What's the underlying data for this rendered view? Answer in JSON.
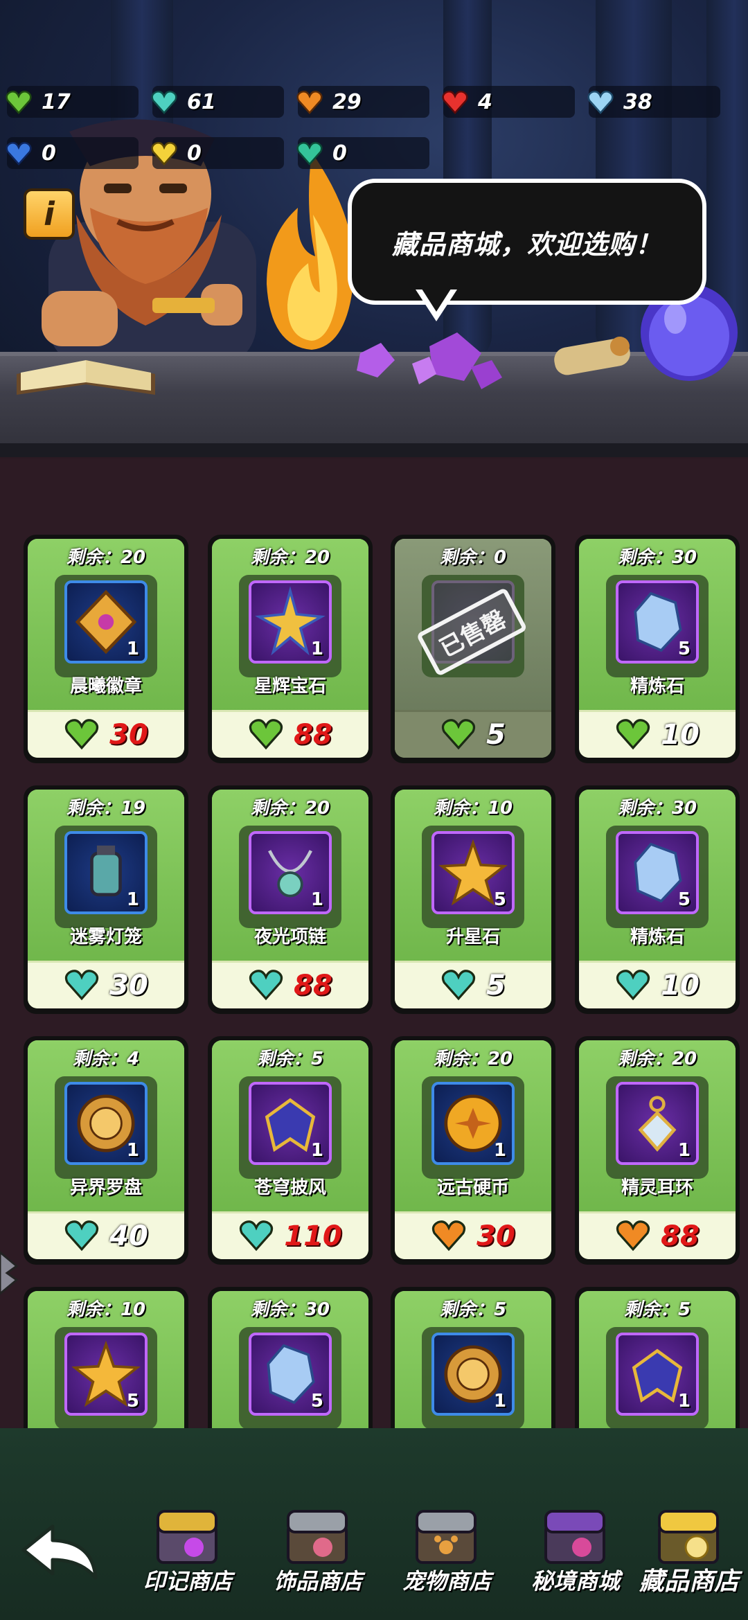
{
  "resources": [
    {
      "icon": "green-heart-gem-icon",
      "color": "#6cc63a",
      "value": "17"
    },
    {
      "icon": "cyan-heart-gem-icon",
      "color": "#4ed0c0",
      "value": "61"
    },
    {
      "icon": "orange-heart-gem-icon",
      "color": "#f08a24",
      "value": "29"
    },
    {
      "icon": "red-heart-gem-icon",
      "color": "#e8322e",
      "value": "4"
    },
    {
      "icon": "lightblue-heart-gem-icon",
      "color": "#9cd4f4",
      "value": "38"
    },
    {
      "icon": "blue-heart-gem-icon",
      "color": "#3a78e0",
      "value": "0"
    },
    {
      "icon": "gold-heart-gem-icon",
      "color": "#f4d23a",
      "value": "0"
    },
    {
      "icon": "teal-heart-gem-icon",
      "color": "#34c49a",
      "value": "0"
    }
  ],
  "info_button": "i",
  "speech_bubble": "藏品商城，欢迎选购！",
  "items": [
    {
      "stock": "剩余：20",
      "name": "晨曦徽章",
      "qty": "1",
      "frame": "blue",
      "icon": "badge-icon",
      "currency": "green",
      "price": "30",
      "price_red": true,
      "sold_out": false
    },
    {
      "stock": "剩余：20",
      "name": "星辉宝石",
      "qty": "1",
      "frame": "purple",
      "icon": "star-gem-icon",
      "currency": "green",
      "price": "88",
      "price_red": true,
      "sold_out": false
    },
    {
      "stock": "剩余：0",
      "name": "",
      "qty": "",
      "frame": "purple",
      "icon": "",
      "currency": "green",
      "price": "5",
      "price_red": false,
      "sold_out": true,
      "stamp": "已售罄"
    },
    {
      "stock": "剩余：30",
      "name": "精炼石",
      "qty": "5",
      "frame": "purple",
      "icon": "crystal-icon",
      "currency": "green",
      "price": "10",
      "price_red": false,
      "sold_out": false
    },
    {
      "stock": "剩余：19",
      "name": "迷雾灯笼",
      "qty": "1",
      "frame": "blue",
      "icon": "lantern-icon",
      "currency": "cyan",
      "price": "30",
      "price_red": false,
      "sold_out": false
    },
    {
      "stock": "剩余：20",
      "name": "夜光项链",
      "qty": "1",
      "frame": "purple",
      "icon": "necklace-icon",
      "currency": "cyan",
      "price": "88",
      "price_red": true,
      "sold_out": false
    },
    {
      "stock": "剩余：10",
      "name": "升星石",
      "qty": "5",
      "frame": "purple",
      "icon": "star-stone-icon",
      "currency": "cyan",
      "price": "5",
      "price_red": false,
      "sold_out": false
    },
    {
      "stock": "剩余：30",
      "name": "精炼石",
      "qty": "5",
      "frame": "purple",
      "icon": "crystal-icon",
      "currency": "cyan",
      "price": "10",
      "price_red": false,
      "sold_out": false
    },
    {
      "stock": "剩余：4",
      "name": "异界罗盘",
      "qty": "1",
      "frame": "blue",
      "icon": "compass-icon",
      "currency": "cyan",
      "price": "40",
      "price_red": false,
      "sold_out": false
    },
    {
      "stock": "剩余：5",
      "name": "苍穹披风",
      "qty": "1",
      "frame": "purple",
      "icon": "cloak-icon",
      "currency": "cyan",
      "price": "110",
      "price_red": true,
      "sold_out": false
    },
    {
      "stock": "剩余：20",
      "name": "远古硬币",
      "qty": "1",
      "frame": "blue",
      "icon": "coin-icon",
      "currency": "orange",
      "price": "30",
      "price_red": true,
      "sold_out": false
    },
    {
      "stock": "剩余：20",
      "name": "精灵耳环",
      "qty": "1",
      "frame": "purple",
      "icon": "earring-icon",
      "currency": "orange",
      "price": "88",
      "price_red": true,
      "sold_out": false
    },
    {
      "stock": "剩余：10",
      "name": "",
      "qty": "5",
      "frame": "purple",
      "icon": "star-stone-icon",
      "currency": "",
      "price": "",
      "price_red": false,
      "sold_out": false
    },
    {
      "stock": "剩余：30",
      "name": "",
      "qty": "5",
      "frame": "purple",
      "icon": "crystal-icon",
      "currency": "",
      "price": "",
      "price_red": false,
      "sold_out": false
    },
    {
      "stock": "剩余：5",
      "name": "",
      "qty": "1",
      "frame": "blue",
      "icon": "compass-icon",
      "currency": "",
      "price": "",
      "price_red": false,
      "sold_out": false
    },
    {
      "stock": "剩余：5",
      "name": "",
      "qty": "1",
      "frame": "purple",
      "icon": "cloak-icon",
      "currency": "",
      "price": "",
      "price_red": false,
      "sold_out": false
    }
  ],
  "tabs": [
    {
      "label": "印记商店",
      "icon": "seal-chest-icon",
      "active": false
    },
    {
      "label": "饰品商店",
      "icon": "accessory-chest-icon",
      "active": false
    },
    {
      "label": "宠物商店",
      "icon": "pet-chest-icon",
      "active": false
    },
    {
      "label": "秘境商城",
      "icon": "secret-chest-icon",
      "active": false
    },
    {
      "label": "藏品商店",
      "icon": "collection-chest-icon",
      "active": true
    }
  ],
  "currency_colors": {
    "green": "#6cc63a",
    "cyan": "#4ed0c0",
    "orange": "#f08a24"
  }
}
